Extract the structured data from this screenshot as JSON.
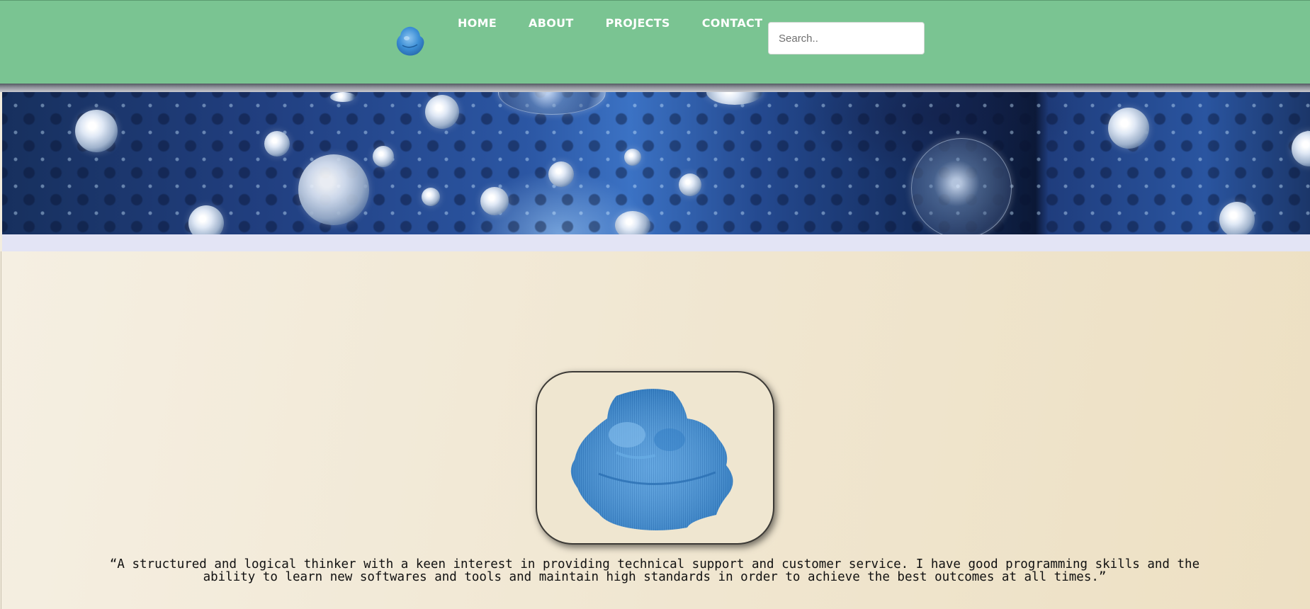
{
  "nav": {
    "items": [
      {
        "label": "HOME"
      },
      {
        "label": "ABOUT"
      },
      {
        "label": "PROJECTS"
      },
      {
        "label": "CONTACT"
      }
    ]
  },
  "search": {
    "placeholder": "Search..",
    "value": ""
  },
  "profile": {
    "quote": "“A structured and logical thinker with a keen interest in providing technical support and customer service. I have good programming skills and the ability to learn new softwares and tools and maintain high standards in order to achieve the best outcomes at all times.”"
  },
  "colors": {
    "header_bg": "#7ac492",
    "banner_blue": "#2b56a3",
    "page_bg": "#f3eddf",
    "accent_blue": "#3d8fd6"
  },
  "icons": {
    "logo": "blue-face-logo-icon",
    "profile_image": "blue-face-avatar"
  }
}
